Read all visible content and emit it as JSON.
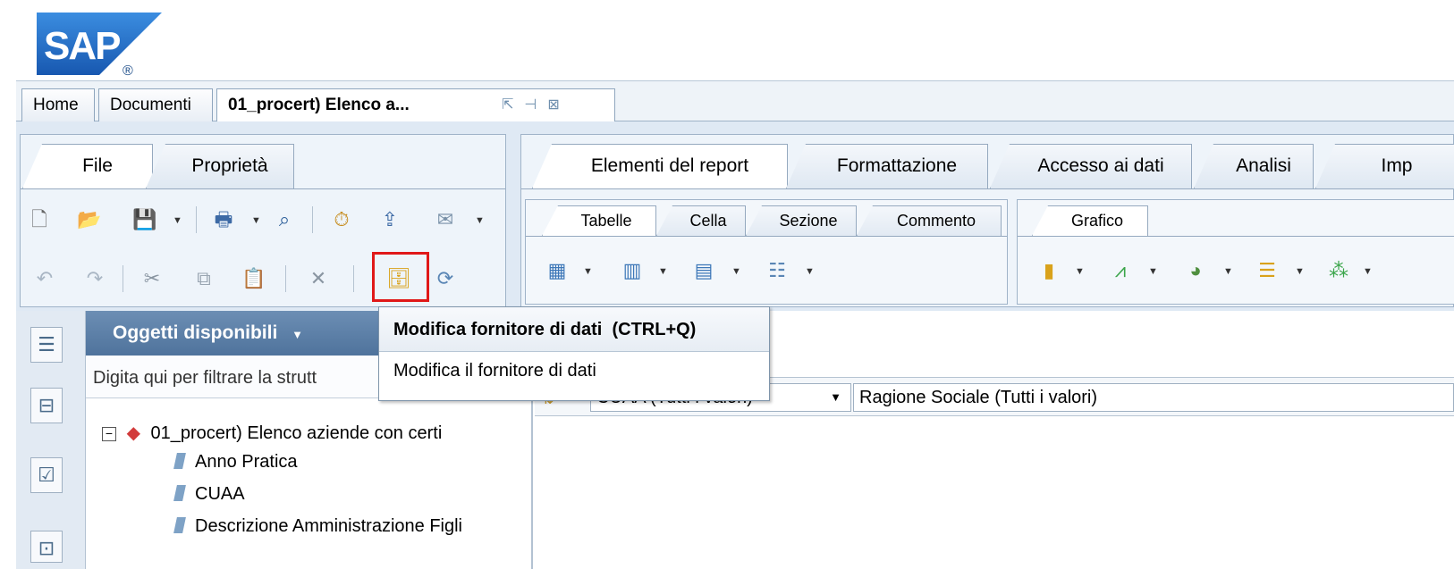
{
  "logo": {
    "text": "SAP",
    "mark": "®",
    "color": "#1f6fc5"
  },
  "doc_tabs": [
    {
      "label": "Home"
    },
    {
      "label": "Documenti"
    },
    {
      "label": "01_procert) Elenco a..."
    }
  ],
  "left_toolbar": {
    "tabs": [
      {
        "label": "File"
      },
      {
        "label": "Proprietà"
      }
    ]
  },
  "ribbon": {
    "tabs": [
      {
        "label": "Elementi del report"
      },
      {
        "label": "Formattazione"
      },
      {
        "label": "Accesso ai dati"
      },
      {
        "label": "Analisi"
      },
      {
        "label": "Imp"
      }
    ],
    "subtabs": [
      {
        "label": "Tabelle"
      },
      {
        "label": "Cella"
      },
      {
        "label": "Sezione"
      },
      {
        "label": "Commento"
      },
      {
        "label": "Grafico"
      }
    ]
  },
  "objects_panel": {
    "title": "Oggetti disponibili",
    "filter_placeholder": "Digita qui per filtrare la strutt",
    "root_label": "01_procert) Elenco aziende con certi",
    "items": [
      {
        "label": "Anno Pratica"
      },
      {
        "label": "CUAA"
      },
      {
        "label": "Descrizione Amministrazione Figli"
      }
    ]
  },
  "filter_bar": {
    "cells": [
      {
        "label": "CUAA (Tutti i valori)"
      },
      {
        "label": "Ragione Sociale (Tutti i valori)"
      }
    ]
  },
  "tooltip": {
    "title": "Modifica fornitore di dati",
    "shortcut": "(CTRL+Q)",
    "description": "Modifica il fornitore di dati"
  },
  "colors": {
    "highlight": "#e01818",
    "header_blue": "#5a7ea8"
  }
}
